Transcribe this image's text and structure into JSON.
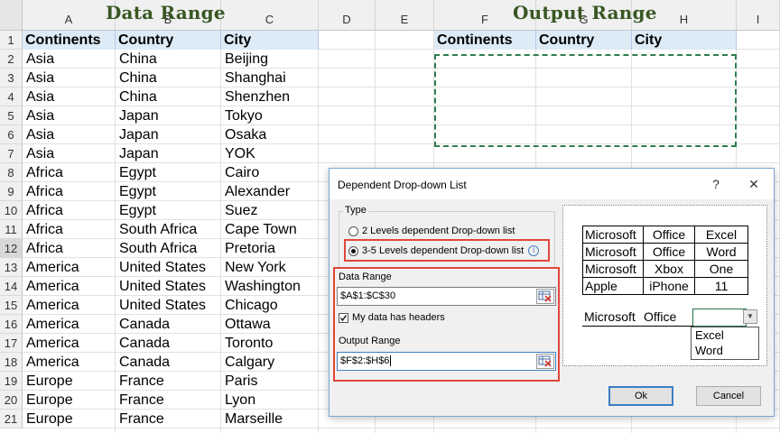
{
  "range_titles": {
    "data": "Data Range",
    "output": "Output Range"
  },
  "columns": [
    "A",
    "B",
    "C",
    "D",
    "E",
    "F",
    "G",
    "H",
    "I"
  ],
  "row_numbers": [
    "1",
    "2",
    "3",
    "4",
    "5",
    "6",
    "7",
    "8",
    "9",
    "10",
    "11",
    "12",
    "13",
    "14",
    "15",
    "16",
    "17",
    "18",
    "19",
    "20",
    "21"
  ],
  "headers": [
    "Continents",
    "Country",
    "City"
  ],
  "rows": [
    [
      "Asia",
      "China",
      "Beijing"
    ],
    [
      "Asia",
      "China",
      "Shanghai"
    ],
    [
      "Asia",
      "China",
      "Shenzhen"
    ],
    [
      "Asia",
      "Japan",
      "Tokyo"
    ],
    [
      "Asia",
      "Japan",
      "Osaka"
    ],
    [
      "Asia",
      "Japan",
      "YOK"
    ],
    [
      "Africa",
      "Egypt",
      "Cairo"
    ],
    [
      "Africa",
      "Egypt",
      "Alexander"
    ],
    [
      "Africa",
      "Egypt",
      "Suez"
    ],
    [
      "Africa",
      "South Africa",
      "Cape Town"
    ],
    [
      "Africa",
      "South Africa",
      "Pretoria"
    ],
    [
      "America",
      "United States",
      "New York"
    ],
    [
      "America",
      "United States",
      "Washington"
    ],
    [
      "America",
      "United States",
      "Chicago"
    ],
    [
      "America",
      "Canada",
      "Ottawa"
    ],
    [
      "America",
      "Canada",
      "Toronto"
    ],
    [
      "America",
      "Canada",
      "Calgary"
    ],
    [
      "Europe",
      "France",
      "Paris"
    ],
    [
      "Europe",
      "France",
      "Lyon"
    ],
    [
      "Europe",
      "France",
      "Marseille"
    ]
  ],
  "output_headers": [
    "Continents",
    "Country",
    "City"
  ],
  "dialog": {
    "title": "Dependent Drop-down List",
    "help": "?",
    "close": "✕",
    "type_label": "Type",
    "option_2": "2 Levels dependent Drop-down list",
    "option_3_5": "3-5 Levels dependent Drop-down list",
    "info": "i",
    "data_range_label": "Data Range",
    "data_range_value": "$A$1:$C$30",
    "headers_checkbox": "My data has headers",
    "output_range_label": "Output Range",
    "output_range_value": "$F$2:$H$6",
    "ok": "Ok",
    "cancel": "Cancel"
  },
  "preview": {
    "table": [
      [
        "Microsoft",
        "Office",
        "Excel"
      ],
      [
        "Microsoft",
        "Office",
        "Word"
      ],
      [
        "Microsoft",
        "Xbox",
        "One"
      ],
      [
        "Apple",
        "iPhone",
        "11"
      ]
    ],
    "dropdown_row": [
      "Microsoft",
      "Office"
    ],
    "dropdown_arrow": "▼",
    "dropdown_options": [
      "Excel",
      "Word"
    ]
  },
  "colors": {
    "header_fill": "#ddebf7",
    "title_green": "#385723",
    "marquee": "#2e7d4f",
    "highlight_red": "#e2463c"
  }
}
